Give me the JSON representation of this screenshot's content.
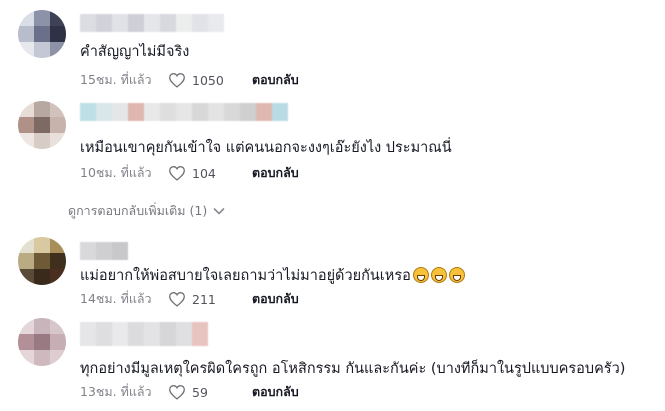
{
  "comments": [
    {
      "text": "คำสัญญาไม่มีจริง",
      "time": "15ชม. ที่แล้ว",
      "likes": "1050",
      "reply_label": "ตอบกลับ",
      "avatar_colors": [
        "#d9dde6",
        "#8c93a8",
        "#3e4257",
        "#b8bdcc",
        "#6a708a",
        "#2f3246",
        "#e6e8ee",
        "#c4c8d4",
        "#8d92a6"
      ]
    },
    {
      "text": "เหมือนเขาคุยกันเข้าใจ แต่คนนอกจะงงๆเอ๊ะยังไง ประมาณนี่",
      "time": "10ชม. ที่แล้ว",
      "likes": "104",
      "reply_label": "ตอบกลับ",
      "avatar_colors": [
        "#e7dcd8",
        "#b7a8a2",
        "#d2c2bc",
        "#b09188",
        "#7e6a64",
        "#c7b3ac",
        "#eee6e2",
        "#d8ccc6",
        "#e9dfdb"
      ]
    },
    {
      "text": "แม่อยากให้พ่อสบายใจเลยถามว่าไม่มาอยู่ด้วยกันเหรอ",
      "time": "14ชม. ที่แล้ว",
      "likes": "211",
      "reply_label": "ตอบกลับ",
      "emoji_count": 3,
      "avatar_colors": [
        "#e4e0d0",
        "#d8c9a0",
        "#a88f5a",
        "#b9ac82",
        "#6e5a36",
        "#3f2f1c",
        "#5a4a38",
        "#3a2a1c",
        "#4a2e20"
      ]
    },
    {
      "text": "ทุกอย่างมีมูลเหตุใครผิดใครถูก อโหสิกรรม กันและกันค่ะ (บางทีก็มาในรูปแบบครอบครัว)",
      "time": "13ชม. ที่แล้ว",
      "likes": "59",
      "reply_label": "ตอบกลับ",
      "avatar_colors": [
        "#e3d7da",
        "#c8b4ba",
        "#d7c6ca",
        "#b38f98",
        "#9a7a82",
        "#c7adb4",
        "#e4d6d9",
        "#cdb9be",
        "#ddcdd1"
      ]
    }
  ],
  "more_replies_label": "ดูการตอบกลับเพิ่มเติม (1)",
  "colors": {
    "text": "#161823",
    "secondary": "#8a8b91"
  },
  "icons": {
    "like": "heart-outline-icon",
    "expand": "chevron-down-icon"
  }
}
